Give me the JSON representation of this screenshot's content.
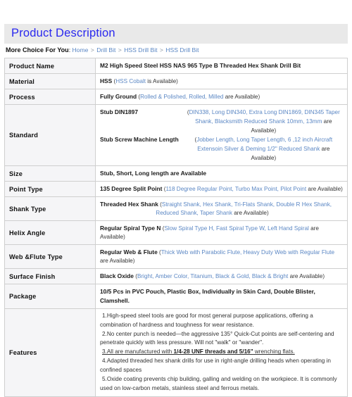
{
  "header": {
    "title": "Product Description"
  },
  "breadcrumb": {
    "label": "More Choice For You",
    "colon": ":",
    "separator": ">",
    "items": [
      {
        "label": "Home"
      },
      {
        "label": "Drill Bit"
      },
      {
        "label": "HSS Drill Bit"
      },
      {
        "label": "HSS Drill Bit"
      }
    ]
  },
  "spec_table": {
    "rows": [
      {
        "label": "Product Name",
        "type": "simple",
        "main": "M2 High Speed Steel HSS NAS 965 Type B Threaded Hex Shank Drill Bit",
        "options": "",
        "tail": ""
      },
      {
        "label": "Material",
        "type": "simple",
        "main": "HSS",
        "open_paren": "(",
        "options": "HSS Cobalt",
        "tail": " is Available",
        "close_paren": ")"
      },
      {
        "label": "Process",
        "type": "simple",
        "main": "Fully Ground",
        "open_paren": "(",
        "options": "Rolled & Polished, Rolled, Milled",
        "tail": " are Available",
        "close_paren": ")"
      },
      {
        "label": "Standard",
        "type": "standard",
        "entries": [
          {
            "key": "Stub DIN1897",
            "open_paren": "(",
            "line1": "DIN338, Long DIN340, Extra Long DIN1869, DIN345 Taper Shank,",
            "line2": "Blacksmith Reduced Shank 10mm, 13mm",
            "tail": " are Available",
            "close_paren": ")"
          },
          {
            "key": "Stub Screw Machine Length",
            "open_paren": "(",
            "line1": "Jobber Length, Long Taper Length, 6 ,12 inch Aircraft Extensoin",
            "line2": "Silver & Deming 1/2\" Reduced Shank",
            "tail": " are Available",
            "close_paren": ")"
          }
        ]
      },
      {
        "label": "Size",
        "type": "simple",
        "main": "Stub, Short, Long length are Available",
        "options": "",
        "tail": ""
      },
      {
        "label": "Point Type",
        "type": "simple",
        "main": "135 Degree Split Point",
        "open_paren": "(",
        "options": "118 Degree Regular Point, Turbo Max Point, Pilot Point",
        "tail": " are Available",
        "close_paren": ")"
      },
      {
        "label": "Shank Type",
        "type": "wrapped",
        "main": "Threaded Hex Shank",
        "open_paren": "(",
        "line1": "Straight Shank, Hex Shank, Tri-Flats Shank, Double R Hex Shank,",
        "line2": "Reduced Shank, Taper Shank",
        "tail": " are Available",
        "close_paren": ")"
      },
      {
        "label": "Helix Angle",
        "type": "simple",
        "main": "Regular Spiral Type N",
        "open_paren": "(",
        "options": "Slow Spiral Type H, Fast Spiral Type W, Left Hand Spiral",
        "tail": " are Available",
        "close_paren": ")"
      },
      {
        "label": "Web &Flute Type",
        "type": "simple",
        "main": "Regular Web & Flute",
        "open_paren": "(",
        "options": "Thick Web with Parabolic Flute, Heavy Duty Web with Regular Flute",
        "tail": " are Available",
        "close_paren": ")"
      },
      {
        "label": "Surface Finish",
        "type": "simple",
        "main": "Black Oxide",
        "open_paren": "(",
        "options": "Bright, Amber Color, Titanium, Black & Gold, Black & Bright",
        "tail": " are Available",
        "close_paren": ")"
      },
      {
        "label": "Package",
        "type": "simple",
        "main": "10/5 Pcs in PVC Pouch, Plastic Box, Individually in Skin Card, Double Blister, Clamshell.",
        "options": "",
        "tail": ""
      }
    ],
    "features": {
      "label": "Features",
      "items": [
        {
          "text": "1.High-speed steel tools are good for most general purpose applications, offering a combination of hardness   and toughness for wear resistance.",
          "underlined": false
        },
        {
          "text": "2.No center punch is needed—the aggressive 135° Quick-Cut points are self-centering and penetrate quickly   with less pressure. Will not \"walk\" or \"wander\".",
          "underlined": false
        },
        {
          "prefix": "3.All are manufactured with ",
          "bold": "1/4-28 UNF threads and 5/16\"",
          "suffix": " wrenching flats.",
          "underlined": true
        },
        {
          "text": "4.Adapted threaded hex shank drills for use in right-angle drilling heads when operating in confined spaces",
          "underlined": false
        },
        {
          "text": "5.Oxide coating prevents chip building, galling and welding on the workpiece. It is commonly used on low-carbon metals, stainless steel and ferrous metals.",
          "underlined": false
        }
      ]
    }
  },
  "colors": {
    "title": "#2a28ef",
    "header_bar": "#e9e9e9",
    "option_link": "#5b87c4",
    "label_cell_bg": "#f5f5f7",
    "border": "#cfcfcf"
  }
}
